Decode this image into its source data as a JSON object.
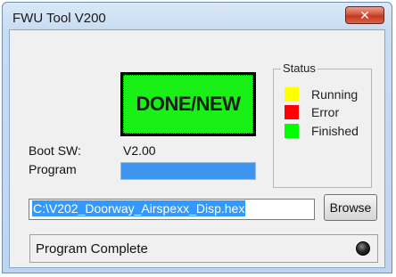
{
  "window": {
    "title": "FWU Tool V200",
    "close_glyph": "✕"
  },
  "main_button": {
    "label": "DONE/NEW",
    "color": "#19f015"
  },
  "status": {
    "legend": "Status",
    "items": [
      {
        "label": "Running",
        "color": "#ffff00"
      },
      {
        "label": "Error",
        "color": "#ff0000"
      },
      {
        "label": "Finished",
        "color": "#00ff00"
      }
    ]
  },
  "boot_sw": {
    "label": "Boot SW:",
    "value": "V2.00"
  },
  "program": {
    "label": "Program",
    "progress": 1.0,
    "bar_color": "#3d95f0"
  },
  "file": {
    "path": "C:\\V202_Doorway_Airspexx_Disp.hex",
    "browse_label": "Browse"
  },
  "statusbar": {
    "message": "Program Complete",
    "led_state": "off"
  }
}
